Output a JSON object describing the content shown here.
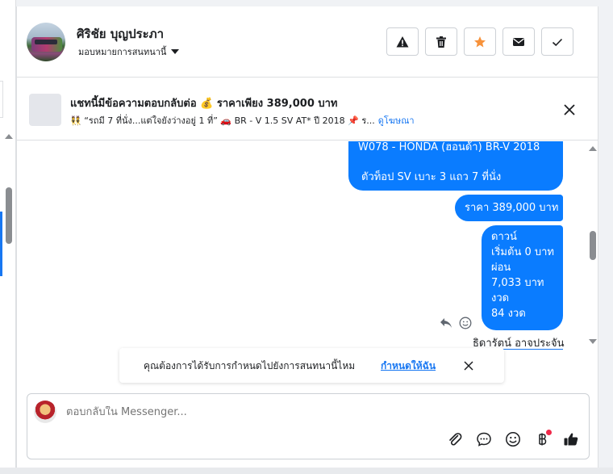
{
  "header": {
    "contact_name": "ศิริชัย บุญประภา",
    "assign_label": "มอบหมายการสนทนานี้",
    "actions": [
      "report-icon",
      "trash-icon",
      "star-icon",
      "mail-icon",
      "check-icon"
    ]
  },
  "ad": {
    "title": "แชทนี้มีข้อความตอบกลับต่อ 💰 ราคาเพียง 389,000 บาท",
    "subtitle": "👯 “รถมี 7 ที่นั่ง...แต่ใจยังว่างอยู่ 1 ที่” 🚗 BR - V 1.5 SV AT* ปี 2018 📌 ร...",
    "see_ad_link": "ดูโฆษณา"
  },
  "messages": [
    {
      "lines": [
        "W078 - HONDA (ฮอนด้า) BR-V 2018",
        "ตัวท็อป SV เบาะ 3 แถว 7 ที่นั่ง"
      ]
    },
    {
      "text": "ราคา 389,000 บาท"
    },
    {
      "lines": [
        "ดาวน์",
        "เริ่มต้น 0 บาท",
        "ผ่อน",
        "7,033 บาท",
        "งวด",
        "84 งวด"
      ]
    }
  ],
  "seen_by": "ธิดารัตน์ อาจประจัน",
  "prompt": {
    "text": "คุณต้องการได้รับการกำหนดไปยังการสนทนานี้ไหม",
    "link": "กำหนดให้ฉัน"
  },
  "composer": {
    "placeholder": "ตอบกลับใน Messenger...",
    "icons": [
      "attach-icon",
      "saved-reply-icon",
      "emoji-icon",
      "baht-icon",
      "like-icon"
    ]
  },
  "colors": {
    "accent": "#1877f2",
    "bubble": "#0a7cff",
    "star": "#f7923b"
  }
}
